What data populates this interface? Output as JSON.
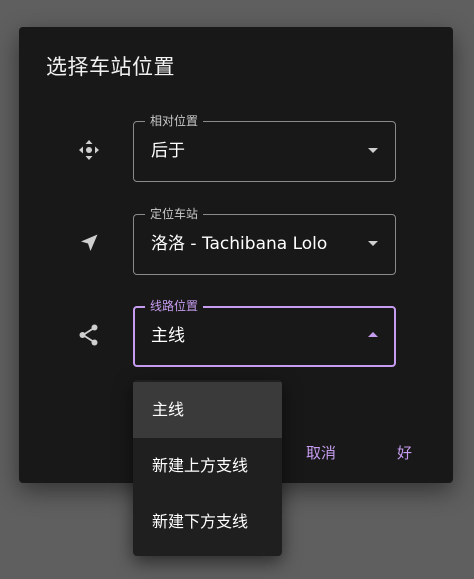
{
  "dialog": {
    "title": "选择车站位置",
    "fields": [
      {
        "label": "相对位置",
        "value": "后于",
        "icon": "move-icon"
      },
      {
        "label": "定位车站",
        "value": "洛洛 - Tachibana Lolo",
        "icon": "navigation-icon"
      },
      {
        "label": "线路位置",
        "value": "主线",
        "icon": "share-icon"
      }
    ],
    "actions": {
      "cancel_label": "取消",
      "ok_label": "好"
    }
  },
  "menu": {
    "options": [
      {
        "label": "主线",
        "selected": true
      },
      {
        "label": "新建上方支线",
        "selected": false
      },
      {
        "label": "新建下方支线",
        "selected": false
      }
    ]
  },
  "colors": {
    "accent": "#c69cf0",
    "dialog_bg": "#181818",
    "scrim": "#5f5f5f",
    "menu_bg": "#1f1f1f",
    "menu_selected": "#3a3a3a"
  }
}
